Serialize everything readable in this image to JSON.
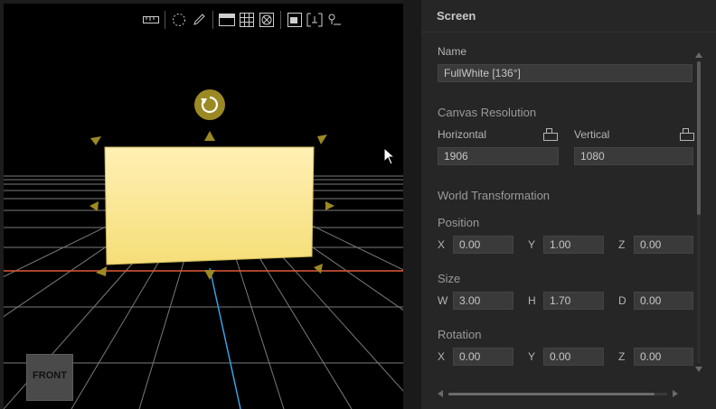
{
  "viewport": {
    "view_label": "FRONT",
    "toolbar_icons": [
      "ruler-icon",
      "dotted-circle-icon",
      "pencil-icon",
      "layout-panel-icon",
      "grid-icon",
      "target-box-icon",
      "screen-icon",
      "frame-select-icon",
      "person-select-icon"
    ],
    "colors": {
      "screen": "#f7e58a",
      "handle": "#9b8a24",
      "grid": "#7a7a7a",
      "x_axis": "#e05a3a",
      "z_axis": "#3aa0e0"
    }
  },
  "panel": {
    "title": "Screen",
    "name_label": "Name",
    "name_value": "FullWhite [136°]",
    "canvas_section": "Canvas Resolution",
    "horizontal_label": "Horizontal",
    "horizontal_value": "1906",
    "vertical_label": "Vertical",
    "vertical_value": "1080",
    "world_section": "World Transformation",
    "position_label": "Position",
    "position": {
      "x_label": "X",
      "x": "0.00",
      "y_label": "Y",
      "y": "1.00",
      "z_label": "Z",
      "z": "0.00"
    },
    "size_label": "Size",
    "size": {
      "w_label": "W",
      "w": "3.00",
      "h_label": "H",
      "h": "1.70",
      "d_label": "D",
      "d": "0.00"
    },
    "rotation_label": "Rotation",
    "rotation": {
      "x_label": "X",
      "x": "0.00",
      "y_label": "Y",
      "y": "0.00",
      "z_label": "Z",
      "z": "0.00"
    }
  }
}
